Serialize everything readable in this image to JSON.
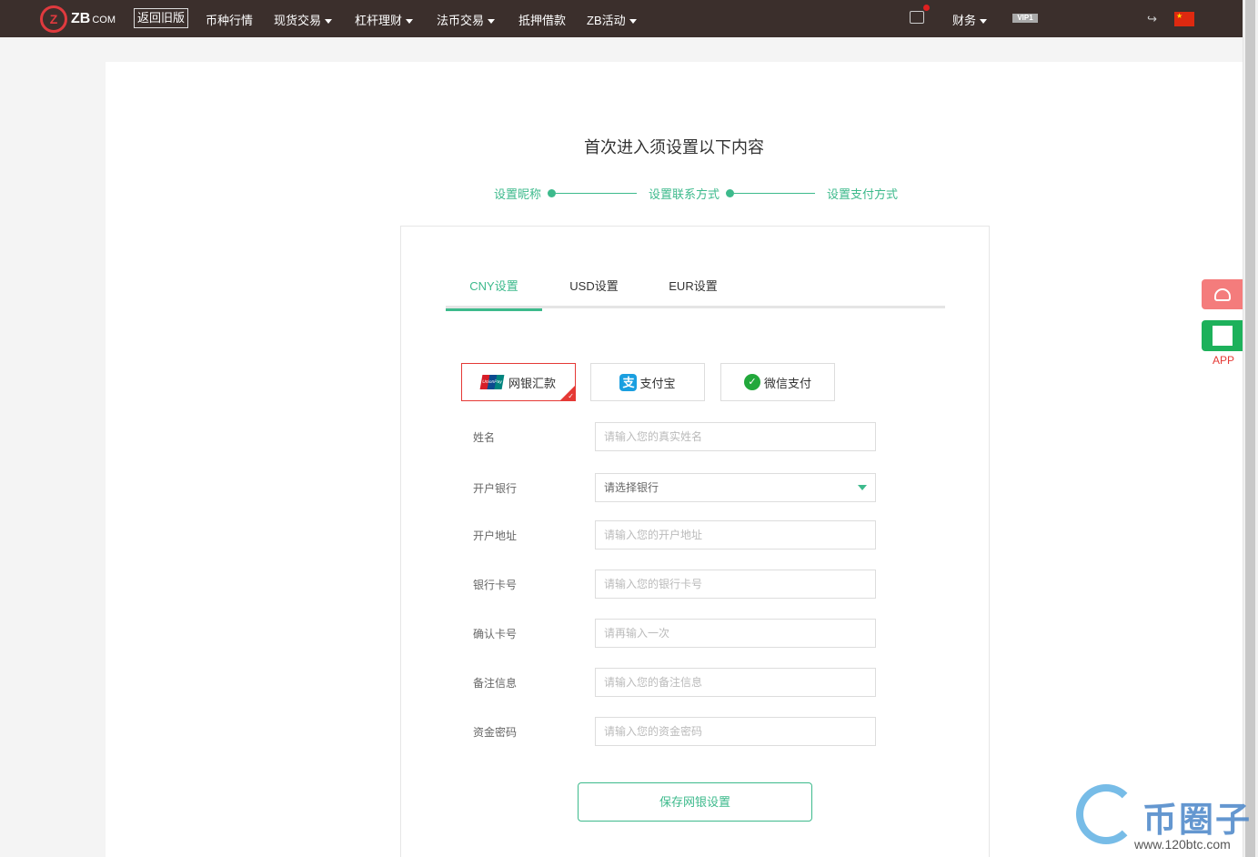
{
  "header": {
    "logo_mark": "Z",
    "logo_text": "ZB",
    "logo_suffix": "COM",
    "old_version_label": "返回旧版",
    "nav": [
      {
        "label": "币种行情",
        "has_caret": false
      },
      {
        "label": "现货交易",
        "has_caret": true
      },
      {
        "label": "杠杆理财",
        "has_caret": true
      },
      {
        "label": "法币交易",
        "has_caret": true
      },
      {
        "label": "抵押借款",
        "has_caret": false
      },
      {
        "label": "ZB活动",
        "has_caret": true
      }
    ],
    "finance_label": "财务",
    "vip_label": "VIP1"
  },
  "main": {
    "title": "首次进入须设置以下内容",
    "steps": [
      "设置昵称",
      "设置联系方式",
      "设置支付方式"
    ],
    "tabs": [
      {
        "label": "CNY设置",
        "active": true
      },
      {
        "label": "USD设置",
        "active": false
      },
      {
        "label": "EUR设置",
        "active": false
      }
    ],
    "payment_methods": [
      {
        "label": "网银汇款",
        "icon": "unionpay-icon",
        "active": true
      },
      {
        "label": "支付宝",
        "icon": "alipay-icon",
        "active": false
      },
      {
        "label": "微信支付",
        "icon": "wechat-pay-icon",
        "active": false
      }
    ],
    "form": {
      "name": {
        "label": "姓名",
        "placeholder": "请输入您的真实姓名"
      },
      "bank": {
        "label": "开户银行",
        "value": "请选择银行"
      },
      "address": {
        "label": "开户地址",
        "placeholder": "请输入您的开户地址"
      },
      "card": {
        "label": "银行卡号",
        "placeholder": "请输入您的银行卡号"
      },
      "confirm_card": {
        "label": "确认卡号",
        "placeholder": "请再输入一次"
      },
      "remark": {
        "label": "备注信息",
        "placeholder": "请输入您的备注信息"
      },
      "fund_password": {
        "label": "资金密码",
        "placeholder": "请输入您的资金密码"
      }
    },
    "save_label": "保存网银设置"
  },
  "side": {
    "app_label": "APP"
  },
  "watermark": {
    "text": "币圈子",
    "url": "www.120btc.com"
  },
  "colors": {
    "accent": "#3dba8c",
    "active_border": "#e53935",
    "topbar": "#3b2f2c"
  }
}
